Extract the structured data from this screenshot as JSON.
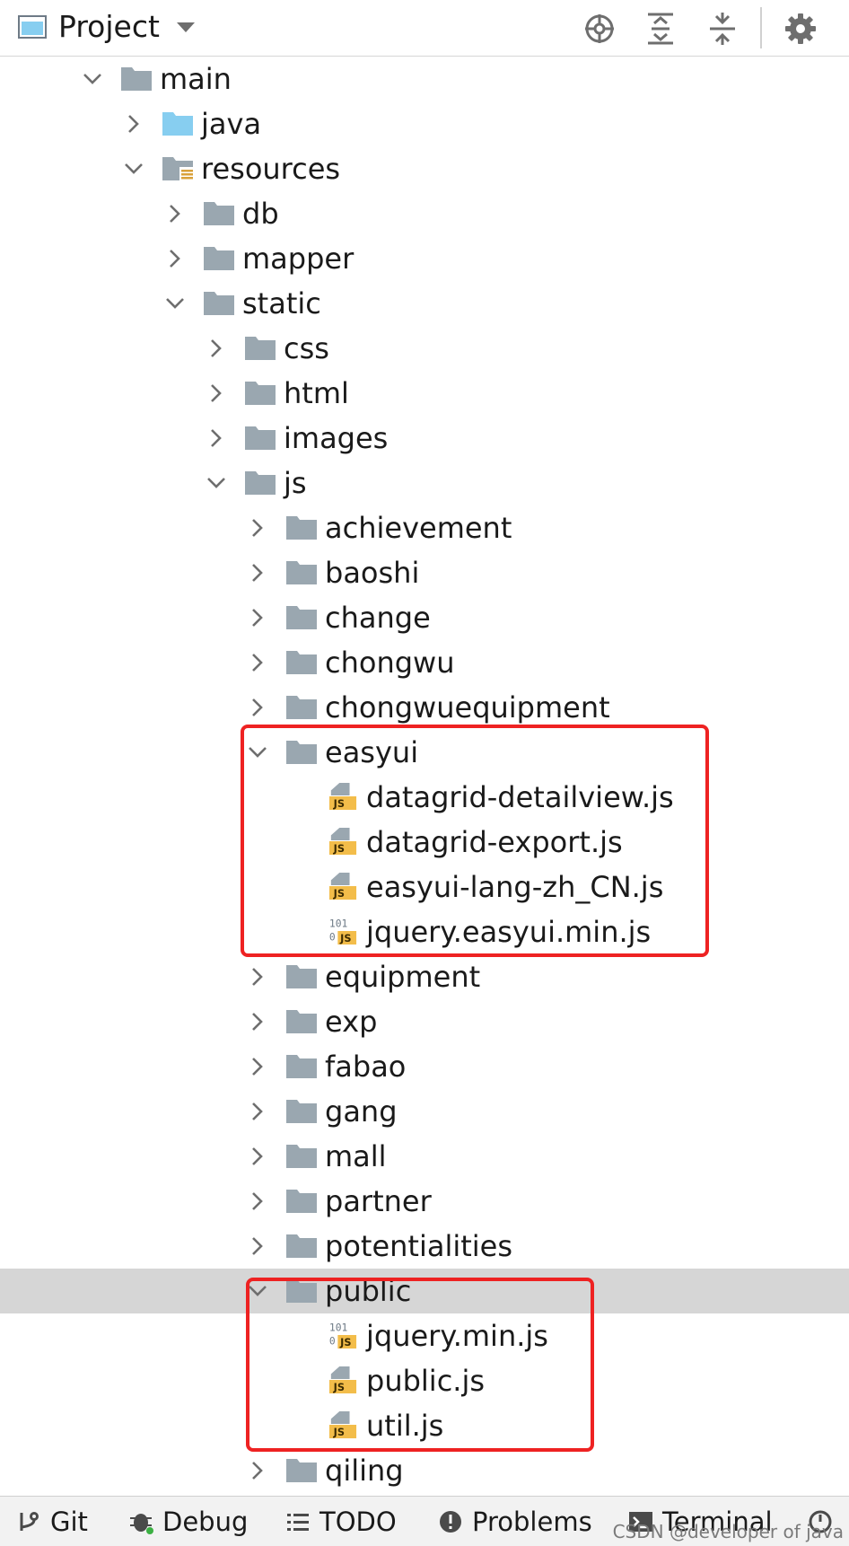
{
  "header": {
    "title": "Project",
    "icons": [
      "project-window-icon",
      "dropdown-caret-icon",
      "locate-icon",
      "expand-all-icon",
      "collapse-all-icon",
      "gear-icon"
    ]
  },
  "tree": [
    {
      "label": "main",
      "depth": 0,
      "expanded": true,
      "kind": "folder"
    },
    {
      "label": "java",
      "depth": 1,
      "expanded": false,
      "kind": "source-folder"
    },
    {
      "label": "resources",
      "depth": 1,
      "expanded": true,
      "kind": "resources-folder"
    },
    {
      "label": "db",
      "depth": 2,
      "expanded": false,
      "kind": "folder"
    },
    {
      "label": "mapper",
      "depth": 2,
      "expanded": false,
      "kind": "folder"
    },
    {
      "label": "static",
      "depth": 2,
      "expanded": true,
      "kind": "folder"
    },
    {
      "label": "css",
      "depth": 3,
      "expanded": false,
      "kind": "folder"
    },
    {
      "label": "html",
      "depth": 3,
      "expanded": false,
      "kind": "folder"
    },
    {
      "label": "images",
      "depth": 3,
      "expanded": false,
      "kind": "folder"
    },
    {
      "label": "js",
      "depth": 3,
      "expanded": true,
      "kind": "folder"
    },
    {
      "label": "achievement",
      "depth": 4,
      "expanded": false,
      "kind": "folder"
    },
    {
      "label": "baoshi",
      "depth": 4,
      "expanded": false,
      "kind": "folder"
    },
    {
      "label": "change",
      "depth": 4,
      "expanded": false,
      "kind": "folder"
    },
    {
      "label": "chongwu",
      "depth": 4,
      "expanded": false,
      "kind": "folder"
    },
    {
      "label": "chongwuequipment",
      "depth": 4,
      "expanded": false,
      "kind": "folder"
    },
    {
      "label": "easyui",
      "depth": 4,
      "expanded": true,
      "kind": "folder"
    },
    {
      "label": "datagrid-detailview.js",
      "depth": 5,
      "kind": "js-file"
    },
    {
      "label": "datagrid-export.js",
      "depth": 5,
      "kind": "js-file"
    },
    {
      "label": "easyui-lang-zh_CN.js",
      "depth": 5,
      "kind": "js-file"
    },
    {
      "label": "jquery.easyui.min.js",
      "depth": 5,
      "kind": "min-js-file"
    },
    {
      "label": "equipment",
      "depth": 4,
      "expanded": false,
      "kind": "folder"
    },
    {
      "label": "exp",
      "depth": 4,
      "expanded": false,
      "kind": "folder"
    },
    {
      "label": "fabao",
      "depth": 4,
      "expanded": false,
      "kind": "folder"
    },
    {
      "label": "gang",
      "depth": 4,
      "expanded": false,
      "kind": "folder"
    },
    {
      "label": "mall",
      "depth": 4,
      "expanded": false,
      "kind": "folder"
    },
    {
      "label": "partner",
      "depth": 4,
      "expanded": false,
      "kind": "folder"
    },
    {
      "label": "potentialities",
      "depth": 4,
      "expanded": false,
      "kind": "folder"
    },
    {
      "label": "public",
      "depth": 4,
      "expanded": true,
      "kind": "folder",
      "selected": true
    },
    {
      "label": "jquery.min.js",
      "depth": 5,
      "kind": "min-js-file"
    },
    {
      "label": "public.js",
      "depth": 5,
      "kind": "js-file"
    },
    {
      "label": "util.js",
      "depth": 5,
      "kind": "js-file"
    },
    {
      "label": "qiling",
      "depth": 4,
      "expanded": false,
      "kind": "folder"
    }
  ],
  "statusbar": {
    "tabs": [
      {
        "label": "Git",
        "icon": "git-branch-icon"
      },
      {
        "label": "Debug",
        "icon": "bug-icon"
      },
      {
        "label": "TODO",
        "icon": "list-icon"
      },
      {
        "label": "Problems",
        "icon": "warning-icon"
      },
      {
        "label": "Terminal",
        "icon": "terminal-icon"
      }
    ],
    "watermark": "CSDN @developer of java"
  },
  "colors": {
    "folder": "#9aa7b0",
    "source_folder": "#87cef0",
    "js_badge": "#f3bd4a",
    "highlight": "#ee2222",
    "selected_row": "#d6d6d6"
  }
}
